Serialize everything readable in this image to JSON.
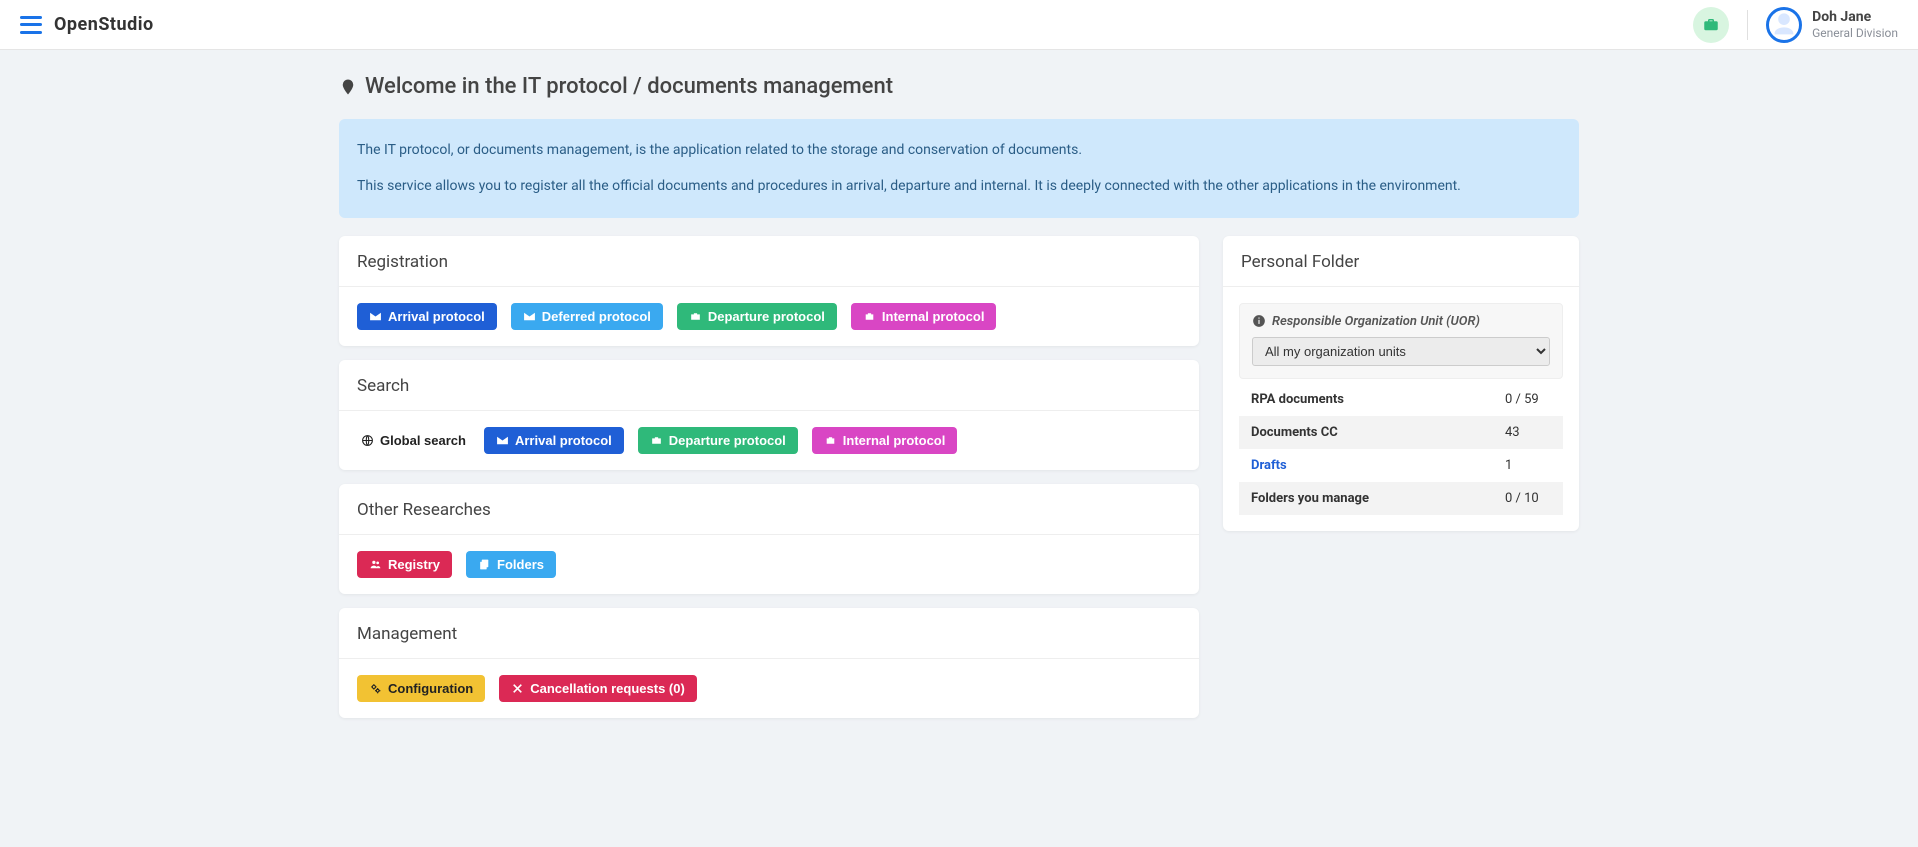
{
  "app": {
    "name": "OpenStudio"
  },
  "user": {
    "name": "Doh Jane",
    "division": "General Division"
  },
  "page": {
    "title": "Welcome in the IT protocol / documents management",
    "info1": "The IT protocol, or documents management, is the application related to the storage and conservation of documents.",
    "info2": "This service allows you to register all the official documents and procedures in arrival, departure and internal. It is deeply connected with the other applications in the environment."
  },
  "sections": {
    "registration": {
      "title": "Registration",
      "buttons": {
        "arrival": "Arrival protocol",
        "deferred": "Deferred protocol",
        "departure": "Departure protocol",
        "internal": "Internal protocol"
      }
    },
    "search": {
      "title": "Search",
      "buttons": {
        "global": "Global search",
        "arrival": "Arrival protocol",
        "departure": "Departure protocol",
        "internal": "Internal protocol"
      }
    },
    "other": {
      "title": "Other Researches",
      "buttons": {
        "registry": "Registry",
        "folders": "Folders"
      }
    },
    "management": {
      "title": "Management",
      "buttons": {
        "configuration": "Configuration",
        "cancellation": "Cancellation requests (0)"
      }
    }
  },
  "side": {
    "title": "Personal Folder",
    "uor_label": "Responsible Organization Unit (UOR)",
    "uor_selected": "All my organization units",
    "rows": {
      "rpa": {
        "label": "RPA documents",
        "value": "0 / 59"
      },
      "cc": {
        "label": "Documents CC",
        "value": "43"
      },
      "drafts": {
        "label": "Drafts",
        "value": "1"
      },
      "folders": {
        "label": "Folders you manage",
        "value": "0 / 10"
      }
    }
  }
}
